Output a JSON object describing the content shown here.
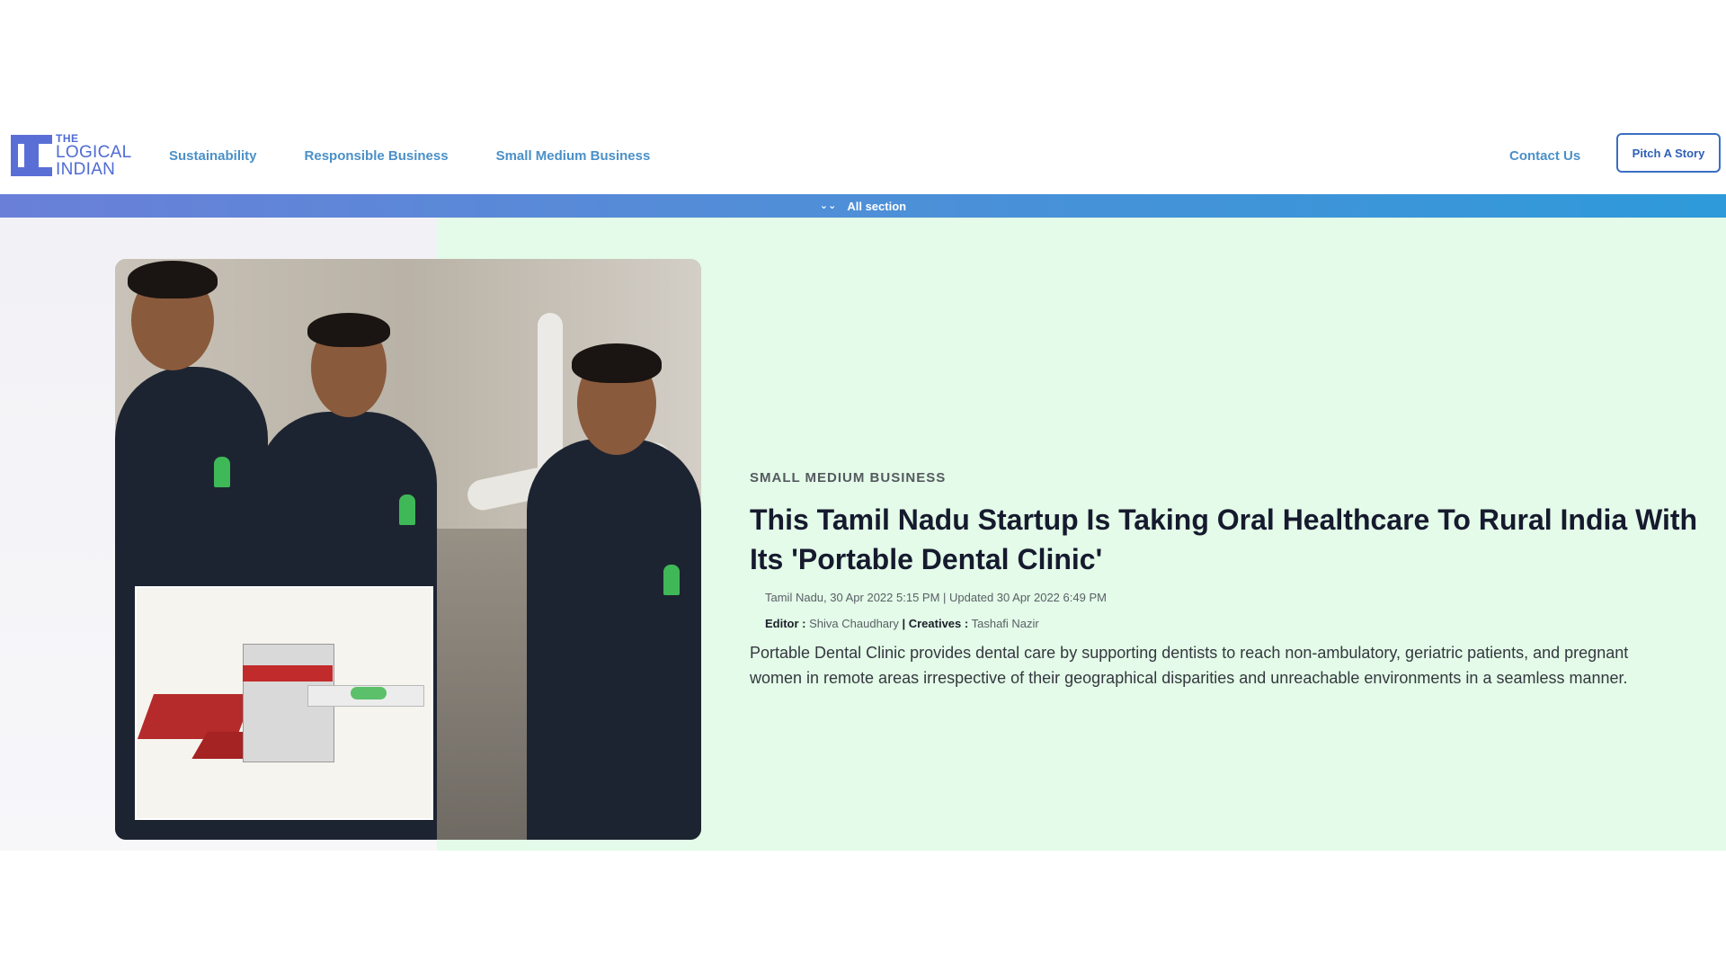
{
  "brand": {
    "logo_line1": "THE",
    "logo_line2": "LOGICAL",
    "logo_line3": "INDIAN",
    "accent": "#4f6bd4"
  },
  "nav": {
    "links": [
      "Sustainability",
      "Responsible Business",
      "Small Medium Business"
    ],
    "contact": "Contact Us",
    "pitch": "Pitch A Story"
  },
  "section_bar": {
    "label": "All section",
    "icon": "double-chevron-down-icon"
  },
  "article": {
    "category": "SMALL MEDIUM BUSINESS",
    "title": "This Tamil Nadu Startup Is Taking Oral Healthcare To Rural India With Its 'Portable Dental Clinic'",
    "location": "Tamil Nadu,",
    "published": "30 Apr 2022 5:15 PM",
    "updated": "| Updated 30 Apr 2022 6:49 PM",
    "editor_label": "Editor :",
    "editor": "Shiva Chaudhary",
    "creatives_label": "| Creatives :",
    "creatives": "Tashafi Nazir",
    "summary": "Portable Dental Clinic provides dental care by supporting dentists to reach non-ambulatory, geriatric patients, and pregnant women in remote areas irrespective of their geographical disparities and unreachable environments in a seamless manner."
  },
  "colors": {
    "hero_bg": "#e3fbe8",
    "nav_text": "#4a90c8",
    "bar_start": "#6a80d8",
    "bar_end": "#2e9ad9"
  }
}
